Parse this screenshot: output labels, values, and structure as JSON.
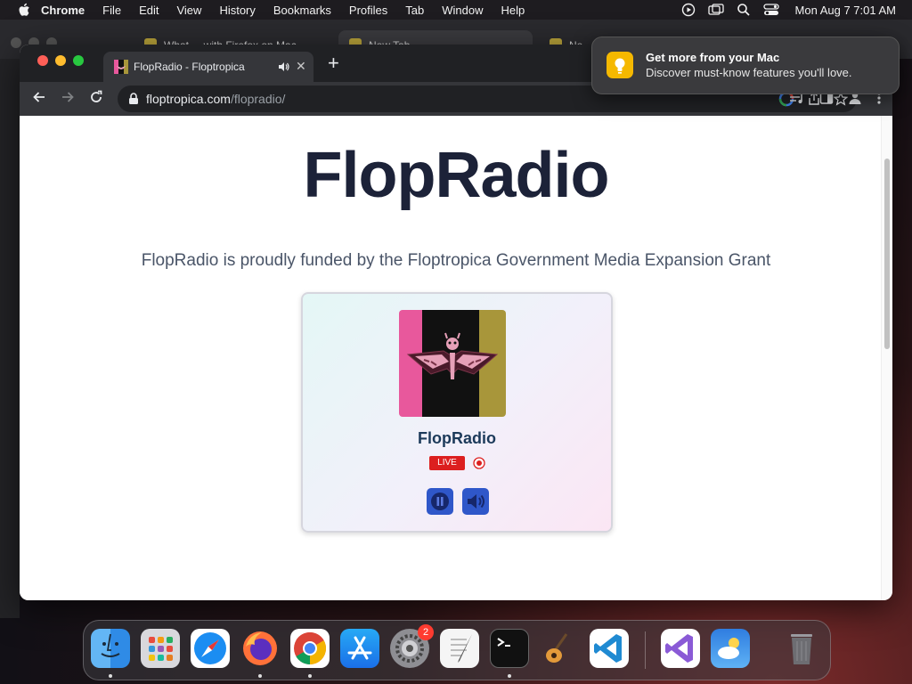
{
  "menubar": {
    "app_name": "Chrome",
    "items": [
      "File",
      "Edit",
      "View",
      "History",
      "Bookmarks",
      "Profiles",
      "Tab",
      "Window",
      "Help"
    ],
    "clock": "Mon Aug 7  7:01 AM"
  },
  "browser": {
    "active_tab": {
      "title": "FlopRadio - Floptropica",
      "close": "✕"
    },
    "background_tabs": [
      "What ... with Firefox on Mac",
      "New Tab",
      "Ne..."
    ],
    "new_tab_label": "+",
    "url": {
      "host": "floptropica.com",
      "path": "/flopradio/"
    }
  },
  "notification": {
    "title": "Get more from your Mac",
    "body": "Discover must-know features you'll love."
  },
  "page": {
    "heading": "FlopRadio",
    "subtitle": "FlopRadio is proudly funded by the Floptropica Government Media Expansion Grant",
    "player": {
      "station_name": "FlopRadio",
      "live_badge": "LIVE",
      "colors": {
        "art_left": "#e8589c",
        "art_middle": "#111111",
        "art_right": "#a8963a",
        "button": "#2f57c9",
        "live": "#dc1f1f"
      }
    }
  },
  "dock": {
    "apps": [
      "finder-icon",
      "launchpad-icon",
      "safari-icon",
      "firefox-icon",
      "chrome-icon",
      "app-store-icon",
      "system-settings-icon",
      "textedit-icon",
      "terminal-icon",
      "garageband-icon",
      "vscode-icon",
      "visual-studio-icon",
      "weather-icon",
      "trash-icon"
    ],
    "settings_badge": "2"
  }
}
